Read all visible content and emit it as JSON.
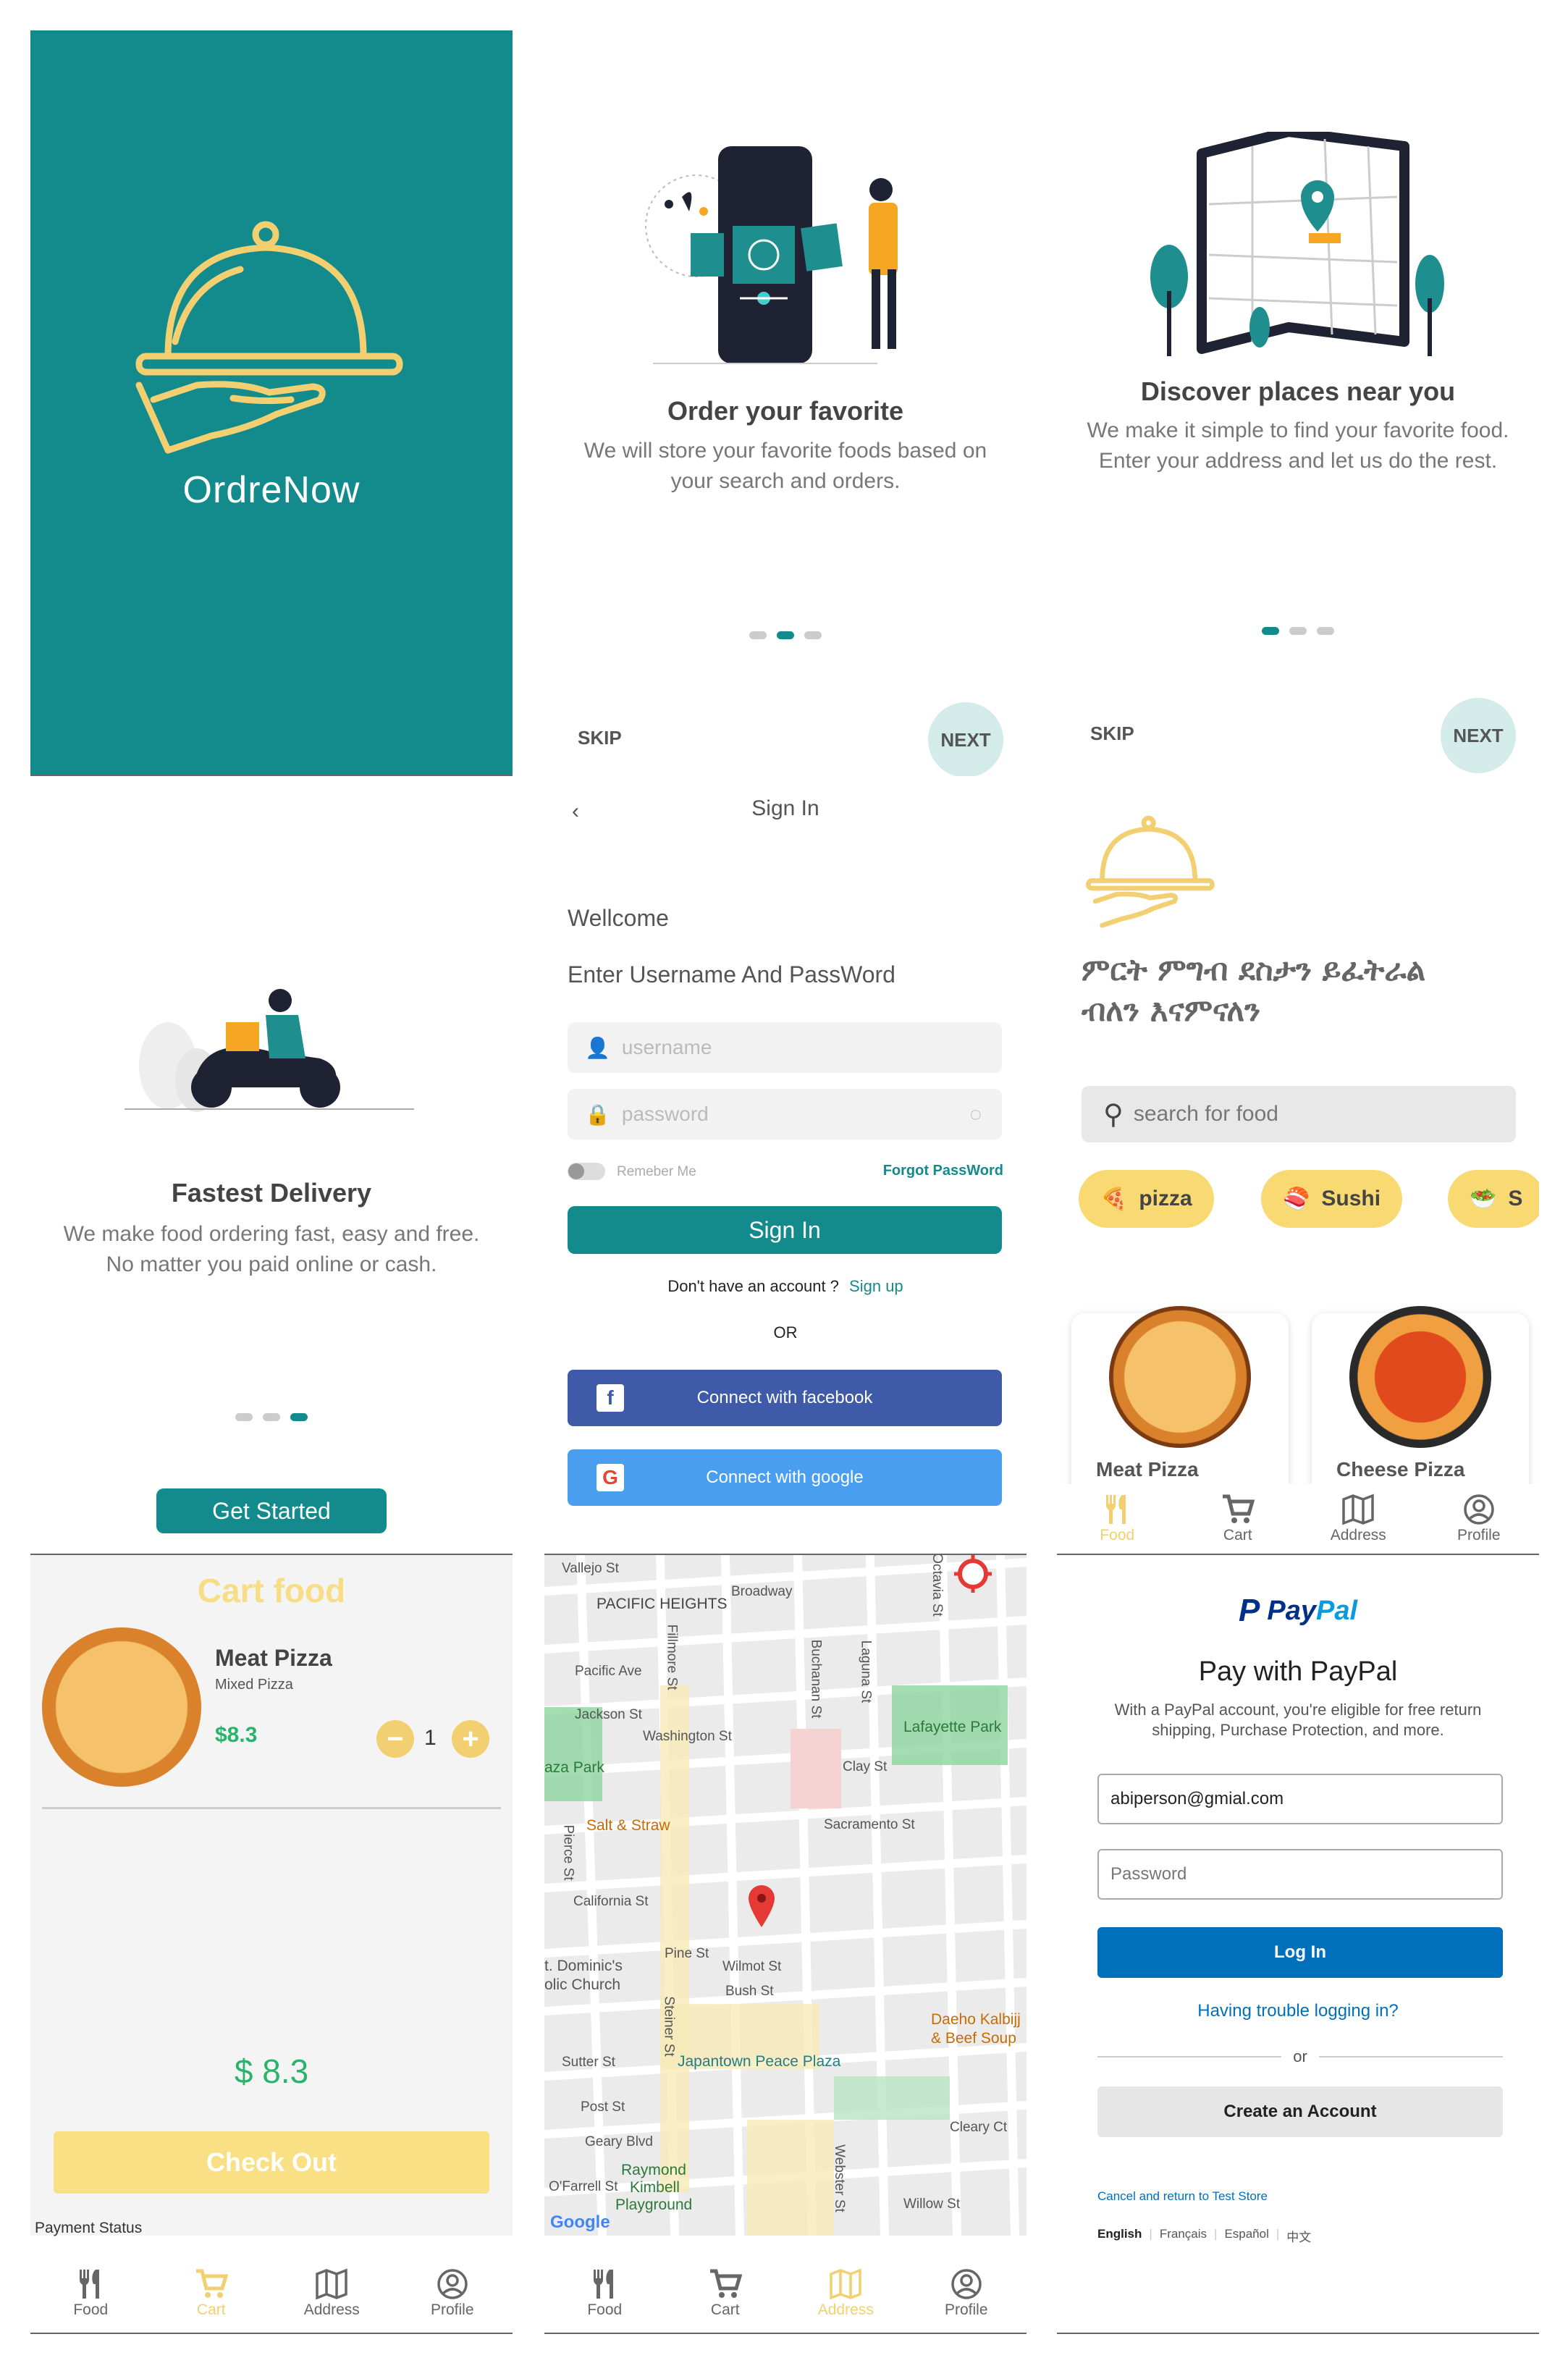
{
  "colors": {
    "teal": "#138a8c",
    "yellow": "#f2d072",
    "chip": "#f9d971",
    "facebook": "#3e5aa8",
    "google": "#4a9ef0",
    "paypal_blue": "#0070ba"
  },
  "splash": {
    "brand": "OrdreNow"
  },
  "onboard1": {
    "title": "Order your favorite",
    "desc": "We will store your favorite foods based on your search and orders.",
    "skip": "SKIP",
    "next": "NEXT"
  },
  "onboard2": {
    "title": "Discover places near you",
    "desc": "We make it simple to find your favorite food. Enter your address and let us do the rest.",
    "skip": "SKIP",
    "next": "NEXT"
  },
  "onboard3": {
    "title": "Fastest Delivery",
    "desc": "We make food ordering fast, easy and free. No matter you paid online or cash.",
    "button": "Get Started"
  },
  "signin": {
    "title": "Sign In",
    "welcome": "Wellcome",
    "subtitle": "Enter Username And PassWord",
    "username_placeholder": "username",
    "password_placeholder": "password",
    "remember": "Remeber Me",
    "forgot": "Forgot PassWord",
    "button": "Sign In",
    "no_account": "Don't have an account ?",
    "signup": "Sign up",
    "or": "OR",
    "facebook": "Connect with facebook",
    "google": "Connect with google"
  },
  "home": {
    "headline_line1": "ምርት ምግብ ደስታን ይፈትራል",
    "headline_line2": "ብለን እናምናለን",
    "search_placeholder": "search for food",
    "chips": [
      {
        "label": "pizza"
      },
      {
        "label": "Sushi"
      },
      {
        "label": "S"
      }
    ],
    "items": [
      {
        "name": "Meat Pizza"
      },
      {
        "name": "Cheese Pizza"
      }
    ]
  },
  "tabs": [
    {
      "label": "Food",
      "icon": "fork-knife-icon"
    },
    {
      "label": "Cart",
      "icon": "cart-icon"
    },
    {
      "label": "Address",
      "icon": "map-icon"
    },
    {
      "label": "Profile",
      "icon": "profile-icon"
    }
  ],
  "cart": {
    "title": "Cart food",
    "item_name": "Meat Pizza",
    "item_sub": "Mixed Pizza",
    "item_price": "$8.3",
    "quantity": "1",
    "total": "$ 8.3",
    "checkout": "Check Out",
    "payment_status": "Payment Status"
  },
  "map": {
    "labels": [
      "Vallejo St",
      "PACIFIC HEIGHTS",
      "Broadway",
      "Octavia St",
      "Pacific Ave",
      "Jackson St",
      "Washington St",
      "Laguna St",
      "Buchanan St",
      "Fillmore St",
      "Lafayette Park",
      "Clay St",
      "aza Park",
      "Salt & Straw",
      "Sacramento St",
      "Pierce St",
      "California St",
      "Pine St",
      "Wilmot St",
      "Bush St",
      "t. Dominic's",
      "olic Church",
      "Steiner St",
      "Daeho Kalbijj",
      "& Beef Soup",
      "Sutter St",
      "Japantown Peace Plaza",
      "Post St",
      "Geary Blvd",
      "Cleary Ct",
      "Raymond",
      "Kimbell",
      "Playground",
      "O'Farrell St",
      "Webster St",
      "Willow St",
      "Google"
    ]
  },
  "paypal": {
    "brand_pay": "Pay",
    "brand_pal": "Pal",
    "title": "Pay with PayPal",
    "desc_line1": "With a PayPal account, you're eligible for free return",
    "desc_line2": "shipping, Purchase Protection, and more.",
    "email": "abiperson@gmial.com",
    "password_placeholder": "Password",
    "login": "Log In",
    "trouble": "Having trouble logging in?",
    "or": "or",
    "create": "Create an Account",
    "cancel": "Cancel and return to Test Store",
    "languages": [
      "English",
      "Français",
      "Español",
      "中文"
    ]
  }
}
